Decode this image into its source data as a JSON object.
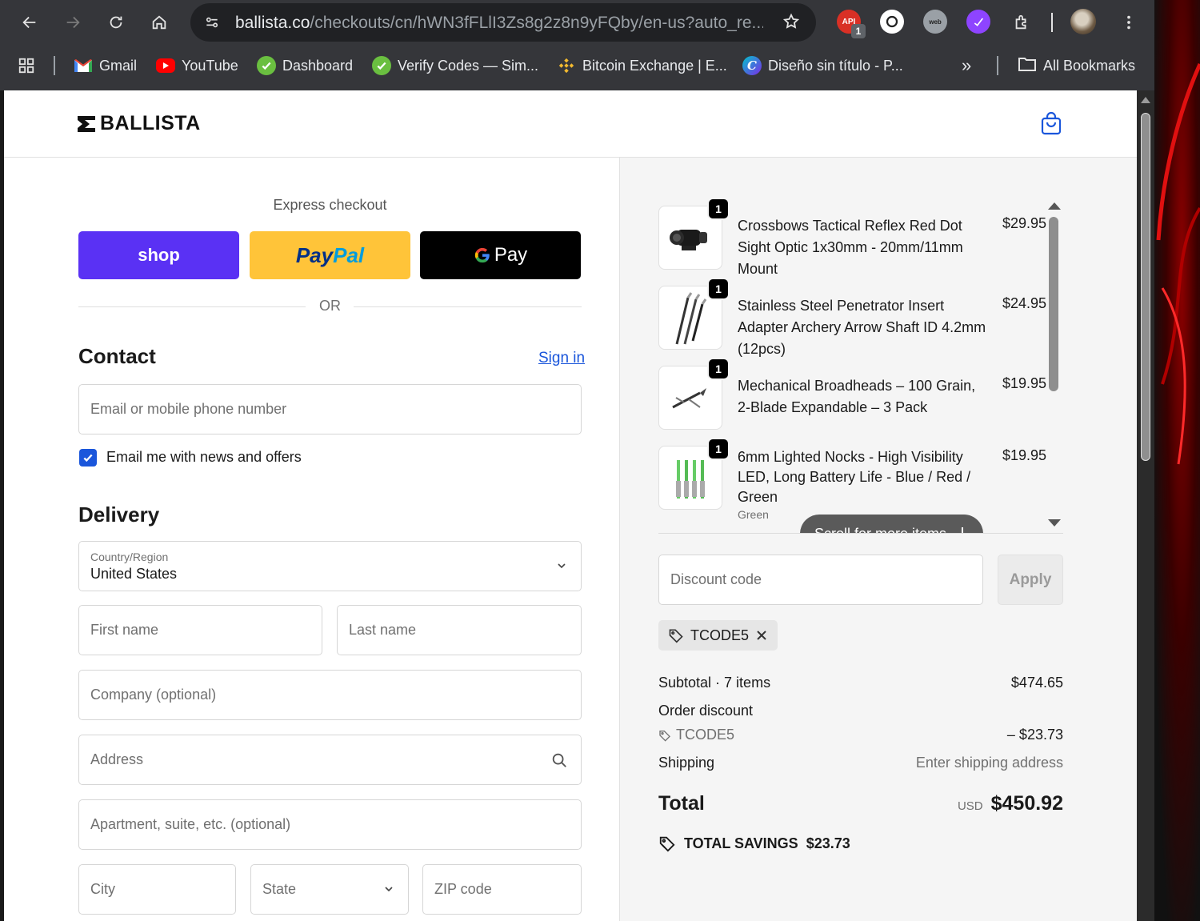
{
  "browser": {
    "url_host": "ballista.co",
    "url_path": "/checkouts/cn/hWN3fFLlI3Zs8g2z8n9yFQby/en-us?auto_re...",
    "extension_badge": "1",
    "extension_label": "API"
  },
  "bookmarks": {
    "items": [
      {
        "label": "Gmail",
        "icon": "gmail-icon",
        "color": "#ea4335"
      },
      {
        "label": "YouTube",
        "icon": "youtube-icon",
        "color": "#ff0000"
      },
      {
        "label": "Dashboard",
        "icon": "check-circle-icon",
        "color": "#4caf50"
      },
      {
        "label": "Verify Codes — Sim...",
        "icon": "check-circle-icon",
        "color": "#4caf50"
      },
      {
        "label": "Bitcoin Exchange | E...",
        "icon": "binance-icon",
        "color": "#f3ba2f"
      },
      {
        "label": "Diseño sin título - P...",
        "icon": "canva-icon",
        "color": "#00c4cc"
      }
    ],
    "more": "»",
    "all_label": "All Bookmarks"
  },
  "header": {
    "brand": "BALLISTA"
  },
  "express": {
    "title": "Express checkout",
    "shop_label": "shop",
    "paypal_pay": "Pay",
    "paypal_pal": "Pal",
    "gpay_label": "Pay",
    "or_label": "OR"
  },
  "contact": {
    "title": "Contact",
    "signin": "Sign in",
    "email_placeholder": "Email or mobile phone number",
    "newsletter_label": "Email me with news and offers",
    "newsletter_checked": true
  },
  "delivery": {
    "title": "Delivery",
    "country_label": "Country/Region",
    "country_value": "United States",
    "first_name": "First name",
    "last_name": "Last name",
    "company": "Company (optional)",
    "address": "Address",
    "apartment": "Apartment, suite, etc. (optional)",
    "city": "City",
    "state": "State",
    "zip": "ZIP code"
  },
  "summary": {
    "items": [
      {
        "qty": "1",
        "name": "Crossbows Tactical Reflex Red Dot Sight Optic 1x30mm - 20mm/11mm Mount",
        "price": "$29.95"
      },
      {
        "qty": "1",
        "name": "Stainless Steel Penetrator Insert Adapter Archery Arrow Shaft ID 4.2mm (12pcs)",
        "price": "$24.95"
      },
      {
        "qty": "1",
        "name": "Mechanical Broadheads – 100 Grain, 2-Blade Expandable – 3 Pack",
        "price": "$19.95"
      },
      {
        "qty": "1",
        "name": "6mm Lighted Nocks - High Visibility LED, Long Battery Life - Blue / Red / Green",
        "price": "$19.95",
        "variant": "Green"
      }
    ],
    "scroll_more": "Scroll for more items",
    "discount_placeholder": "Discount code",
    "apply": "Apply",
    "applied_code": "TCODE5",
    "subtotal_label": "Subtotal · 7 items",
    "subtotal_value": "$474.65",
    "order_discount_label": "Order discount",
    "discount_code": "TCODE5",
    "discount_value": "– $23.73",
    "shipping_label": "Shipping",
    "shipping_value": "Enter shipping address",
    "total_label": "Total",
    "currency": "USD",
    "total_value": "$450.92",
    "savings_label": "TOTAL SAVINGS",
    "savings_value": "$23.73"
  },
  "colors": {
    "accent": "#1a56db",
    "shop": "#5a31f4",
    "paypal": "#ffc439",
    "chrome": "#35363a"
  }
}
